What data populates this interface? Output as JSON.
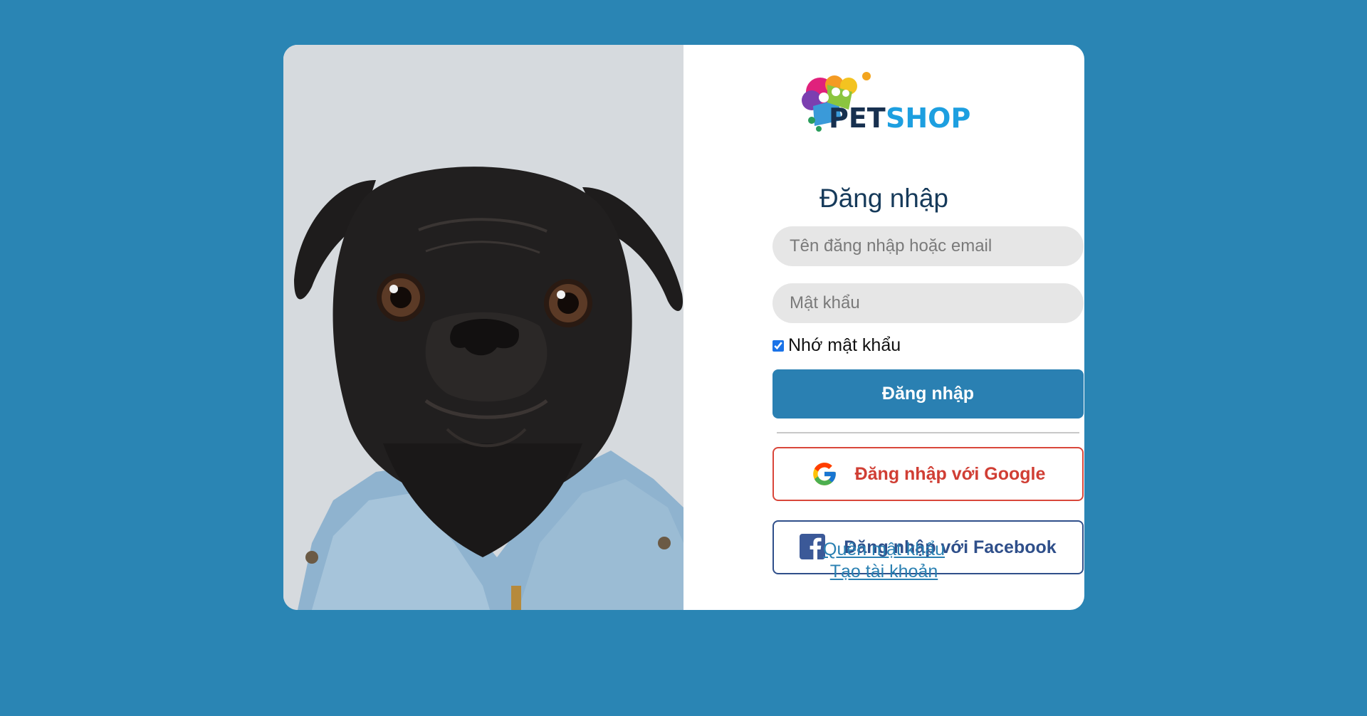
{
  "brand": {
    "logo_text_pet": "PET",
    "logo_text_shop": "SHOP",
    "accent": "#2a80b2",
    "page_bg": "#2a85b4"
  },
  "login": {
    "title": "Đăng nhập",
    "username_placeholder": "Tên đăng nhập hoặc email",
    "password_placeholder": "Mật khẩu",
    "remember_label": "Nhớ mật khẩu",
    "remember_checked": true,
    "submit_label": "Đăng nhập",
    "google_label": "Đăng nhập với Google",
    "facebook_label": "Đăng nhập với Facebook",
    "forgot_link": "Quên mật khẩu",
    "register_link": "Tạo tài khoản"
  },
  "icons": {
    "google": "google-icon",
    "facebook": "facebook-icon"
  }
}
